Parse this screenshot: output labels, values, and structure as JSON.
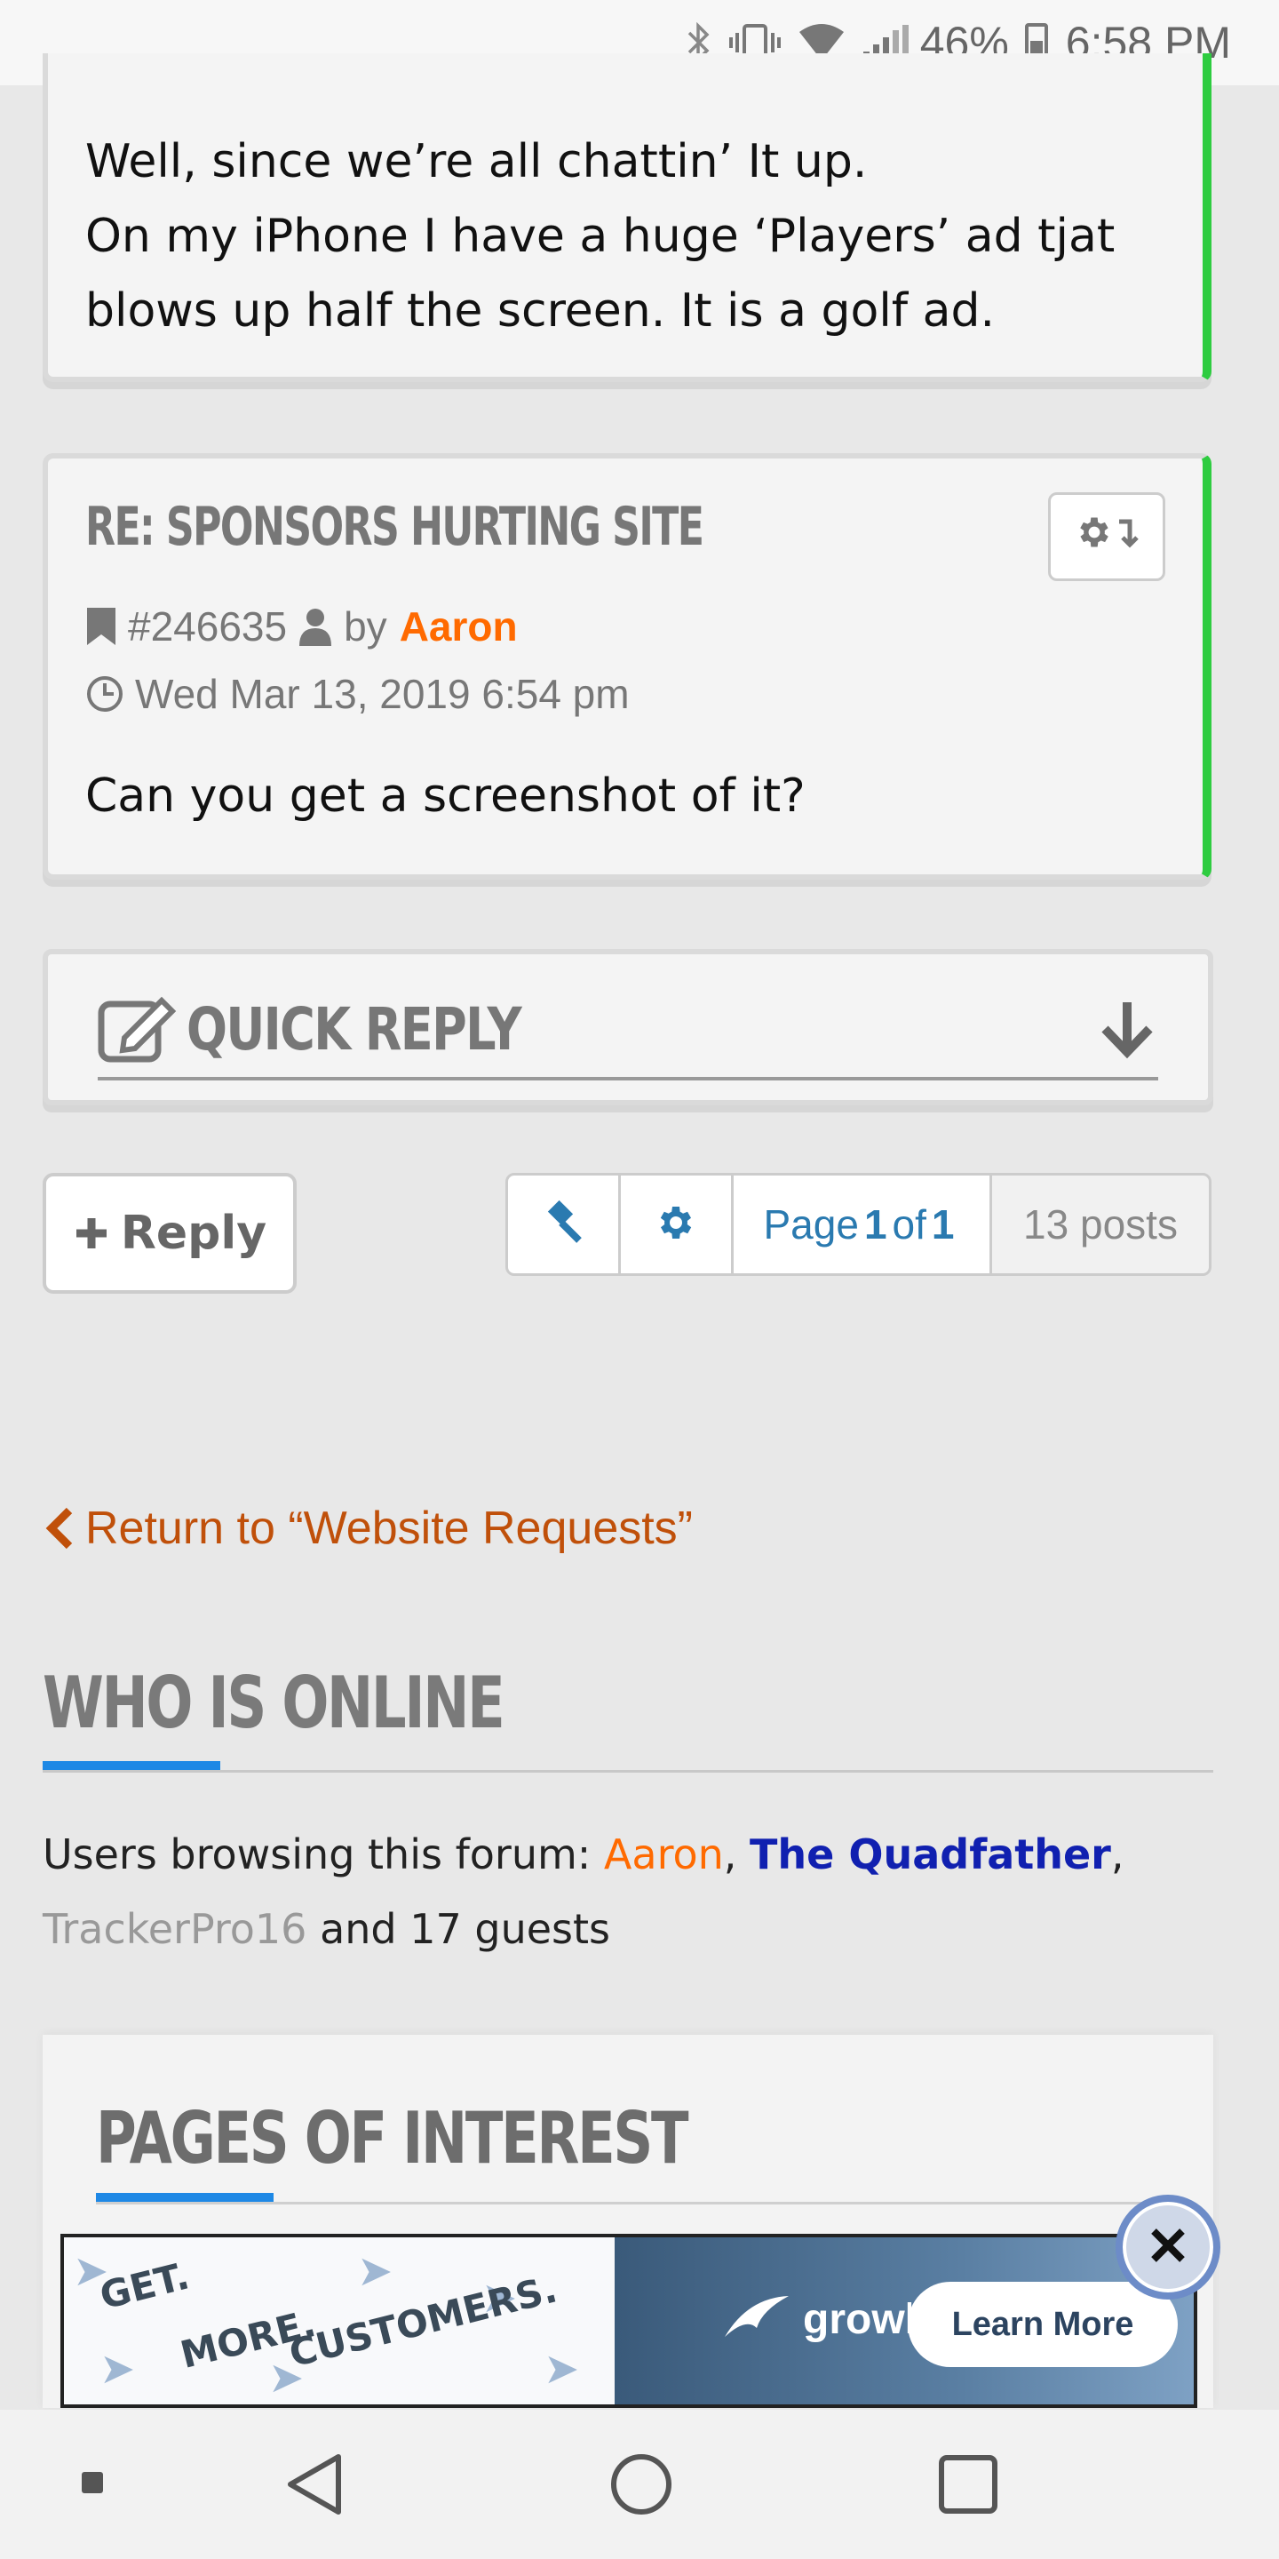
{
  "status_bar": {
    "battery_percent": "46%",
    "time": "6:58 PM",
    "icons": [
      "bluetooth-icon",
      "vibrate-icon",
      "wifi-icon",
      "signal-icon",
      "battery-icon"
    ]
  },
  "post_previous": {
    "body_lines": [
      "Well, since we’re all chattin’ It up.",
      "On my iPhone I have a huge ‘Players’ ad tjat",
      "blows up half the screen. It is a golf ad."
    ]
  },
  "post_current": {
    "title": "RE: SPONSORS HURTING SITE",
    "post_id": "#246635",
    "by_label": "by",
    "author": "Aaron",
    "date": "Wed Mar 13, 2019 6:54 pm",
    "body": "Can you get a screenshot of it?"
  },
  "quick_reply": {
    "label": "QUICK REPLY"
  },
  "reply_button": {
    "label": "Reply"
  },
  "pagination": {
    "page_prefix": "Page",
    "page_current": "1",
    "page_of": "of",
    "page_total": "1",
    "posts": "13 posts"
  },
  "return_link": {
    "label": "Return to “Website Requests”"
  },
  "who_is_online": {
    "title": "WHO IS ONLINE",
    "intro": "Users browsing this forum: ",
    "users": [
      "Aaron",
      "The Quadfather",
      "TrackerPro16"
    ],
    "sep1": ", ",
    "sep2": ",",
    "guests": " and 17 guests"
  },
  "pages_of_interest": {
    "title": "PAGES OF INTEREST"
  },
  "ad": {
    "words": [
      "GET.",
      "MORE.",
      "CUSTOMERS."
    ],
    "brand_bold": "grow",
    "brand_light": "labs",
    "cta": "Learn More"
  },
  "colors": {
    "accent_green": "#2ecc40",
    "author_orange": "#ff6a00",
    "link_blue": "#2a7ab0",
    "return_link": "#c0500a",
    "underline_blue": "#1e88e5"
  }
}
